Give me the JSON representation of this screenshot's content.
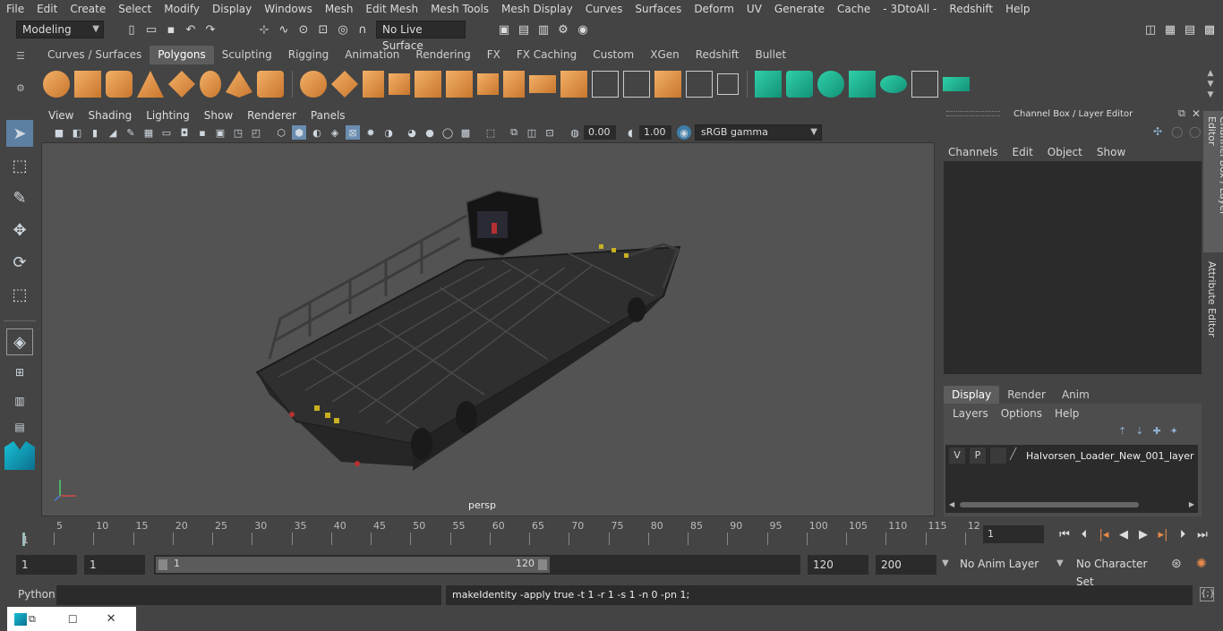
{
  "menubar": {
    "items": [
      "File",
      "Edit",
      "Create",
      "Select",
      "Modify",
      "Display",
      "Windows",
      "Mesh",
      "Edit Mesh",
      "Mesh Tools",
      "Mesh Display",
      "Curves",
      "Surfaces",
      "Deform",
      "UV",
      "Generate",
      "Cache",
      "- 3DtoAll -",
      "Redshift",
      "Help"
    ]
  },
  "status": {
    "mode": "Modeling",
    "live_surface": "No Live Surface"
  },
  "shelf": {
    "tabs": [
      "Curves / Surfaces",
      "Polygons",
      "Sculpting",
      "Rigging",
      "Animation",
      "Rendering",
      "FX",
      "FX Caching",
      "Custom",
      "XGen",
      "Redshift",
      "Bullet"
    ],
    "active_tab": "Polygons"
  },
  "viewport": {
    "menu": [
      "View",
      "Shading",
      "Lighting",
      "Show",
      "Renderer",
      "Panels"
    ],
    "exposure": "0.00",
    "gamma": "1.00",
    "color_space": "sRGB gamma",
    "camera": "persp"
  },
  "channelbox": {
    "title": "Channel Box / Layer Editor",
    "menu": [
      "Channels",
      "Edit",
      "Object",
      "Show"
    ],
    "layer_tabs": [
      "Display",
      "Render",
      "Anim"
    ],
    "layer_menu": [
      "Layers",
      "Options",
      "Help"
    ],
    "layer": {
      "v": "V",
      "p": "P",
      "name": "Halvorsen_Loader_New_001_layer"
    }
  },
  "sidetabs": [
    "Channel Box / Layer Editor",
    "Attribute Editor"
  ],
  "timeline": {
    "ticks": [
      "5",
      "10",
      "15",
      "20",
      "25",
      "30",
      "35",
      "40",
      "45",
      "50",
      "55",
      "60",
      "65",
      "70",
      "75",
      "80",
      "85",
      "90",
      "95",
      "100",
      "105",
      "110",
      "115",
      "12"
    ],
    "start_label": "1",
    "current_frame": "1"
  },
  "range": {
    "start": "1",
    "playback_start": "1",
    "slider_start": "1",
    "slider_end": "120",
    "playback_end": "120",
    "end": "200",
    "anim_layer": "No Anim Layer",
    "char_set": "No Character Set"
  },
  "cmdline": {
    "lang": "Python",
    "result": "makeIdentity -apply true -t 1 -r 1 -s 1 -n 0 -pn 1;"
  }
}
